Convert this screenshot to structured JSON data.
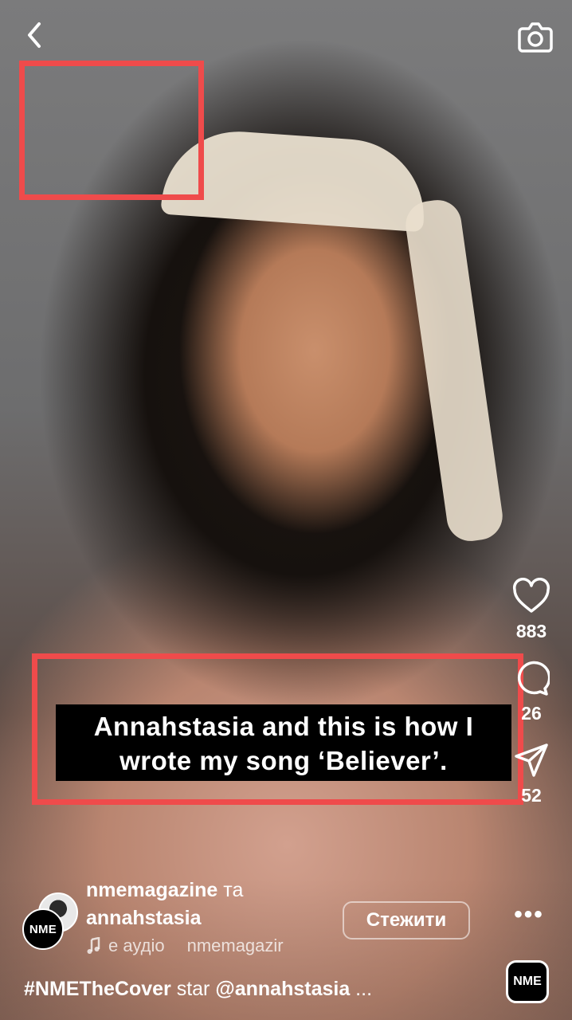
{
  "post": {
    "caption_line1": "Annahstasia and this is how I",
    "caption_line2": "wrote my song ‘Believer’."
  },
  "actions": {
    "likes": "883",
    "comments": "26",
    "shares": "52"
  },
  "author": {
    "name1": "nmemagazine",
    "conj": "та",
    "name2": "annahstasia",
    "avatar_text": "NME",
    "follow_label": "Стежити"
  },
  "audio": {
    "label": "е аудіо",
    "source": "nmemagazir"
  },
  "description": {
    "hashtag": "#NMETheCover",
    "middle": " star ",
    "mention": "@annahstasia",
    "ellipsis": " ..."
  },
  "badge": {
    "text": "NME"
  },
  "colors": {
    "highlight": "#ef4b4b"
  },
  "icons": [
    "back-icon",
    "camera-icon",
    "heart-icon",
    "comment-icon",
    "share-icon",
    "more-icon",
    "music-note-icon"
  ]
}
